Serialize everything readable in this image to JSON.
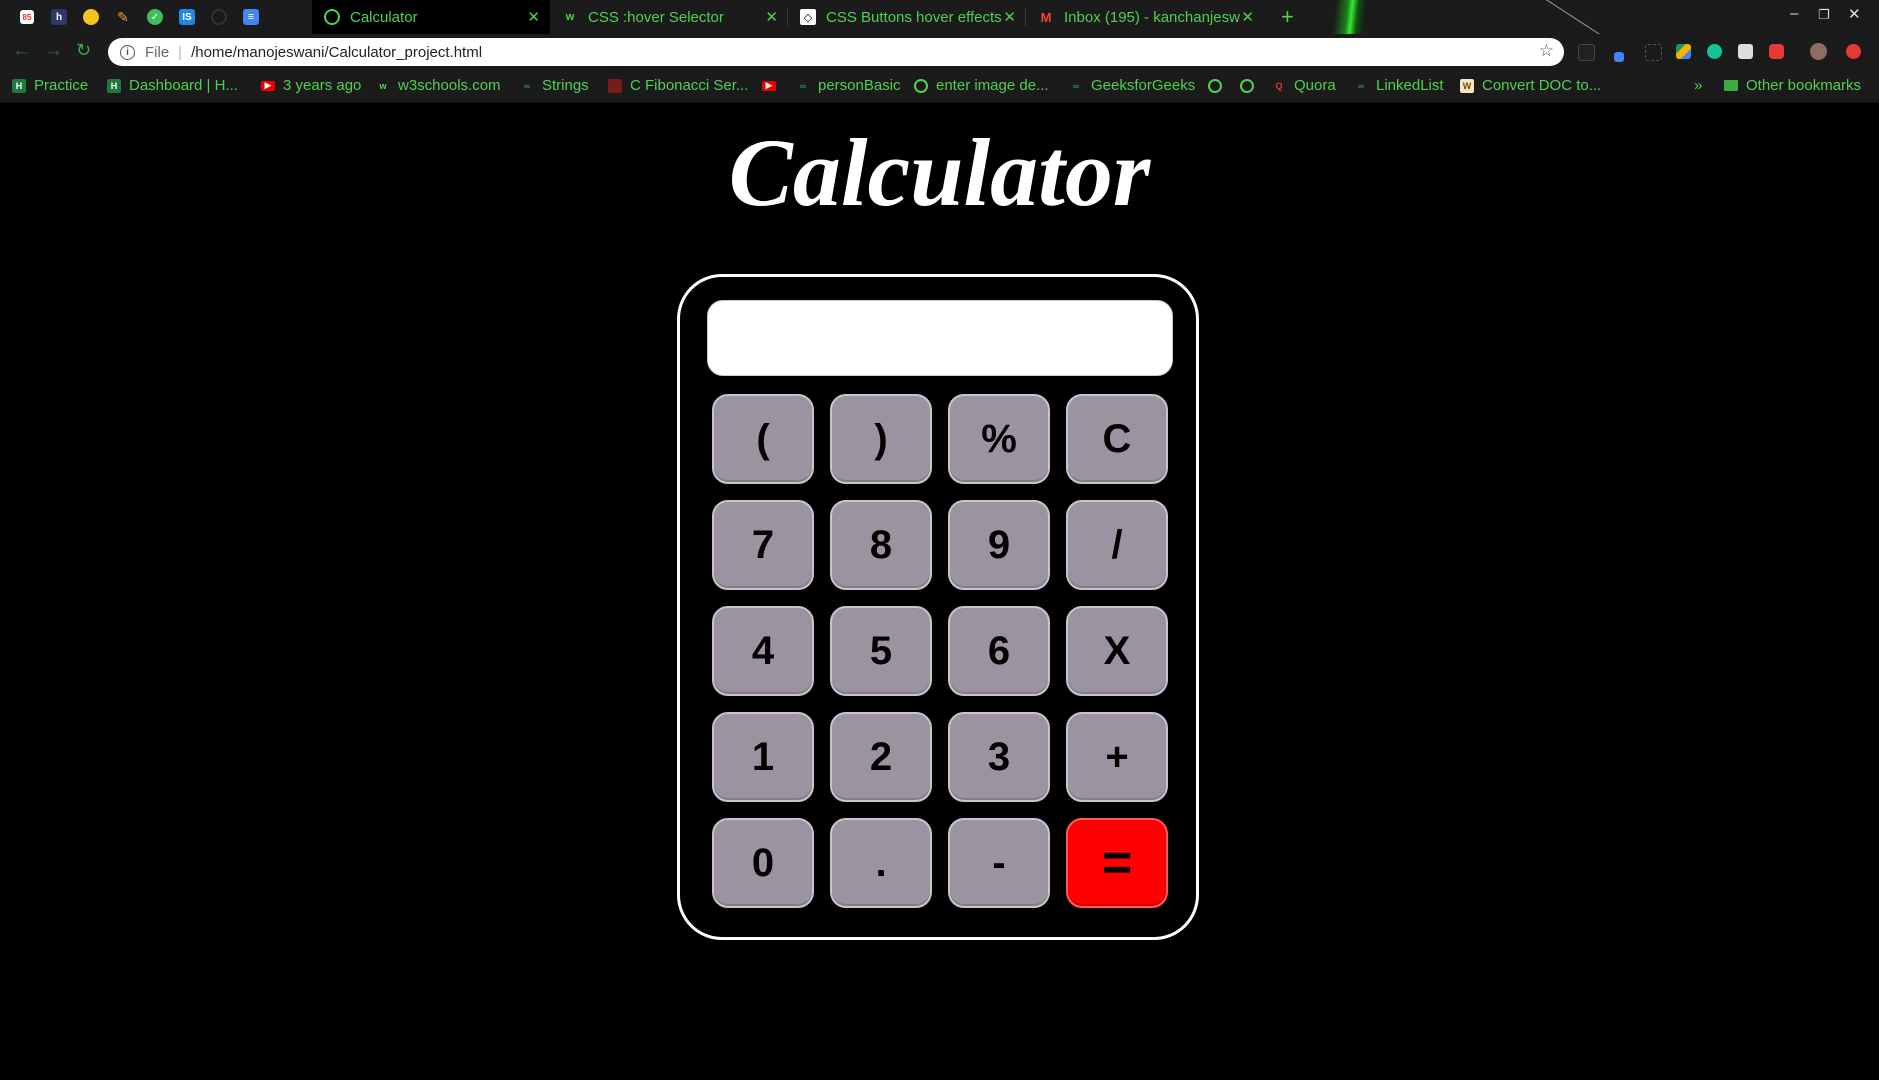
{
  "browser": {
    "tabs": [
      {
        "label": "Calculator",
        "favicon": "globe-icon"
      },
      {
        "label": "CSS :hover Selector",
        "favicon": "w3schools-icon"
      },
      {
        "label": "CSS Buttons hover effects",
        "favicon": "codepen-icon"
      },
      {
        "label": "Inbox (195) - kanchanjesw",
        "favicon": "gmail-icon"
      }
    ],
    "pinned_tabs": [
      "calendar-icon",
      "hackerrank-icon",
      "sun-icon",
      "pen-icon",
      "check-icon",
      "is-icon",
      "circle-icon",
      "docs-icon"
    ],
    "pinned_badge": "85",
    "new_tab": "+",
    "address": {
      "scheme": "File",
      "url": "/home/manojeswani/Calculator_project.html"
    },
    "bookmarks": [
      "Practice",
      "Dashboard | H...",
      "3 years ago",
      "w3schools.com",
      "Strings",
      "C Fibonacci Ser...",
      "",
      "personBasic",
      "enter image de...",
      "GeeksforGeeks",
      "",
      "",
      "Quora",
      "LinkedList",
      "Convert DOC to..."
    ],
    "bookmarks_overflow": "»",
    "other_bookmarks": "Other bookmarks",
    "colors": {
      "accent": "#4fd14f",
      "chrome_bg": "#1b1b1b"
    }
  },
  "page": {
    "title": "Calculator",
    "display_value": "",
    "keys": [
      [
        "(",
        ")",
        "%",
        "C"
      ],
      [
        "7",
        "8",
        "9",
        "/"
      ],
      [
        "4",
        "5",
        "6",
        "X"
      ],
      [
        "1",
        "2",
        "3",
        "+"
      ],
      [
        "0",
        ".",
        "-",
        "="
      ]
    ],
    "colors": {
      "key": "#9c93a0",
      "equals_key": "#ff0000",
      "background": "#000000"
    }
  }
}
